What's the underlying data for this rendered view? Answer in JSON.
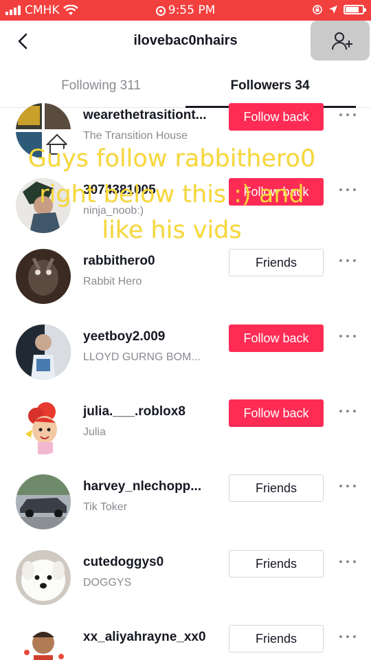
{
  "status_bar": {
    "carrier": "CMHK",
    "time": "9:55 PM",
    "battery_level": 0.8
  },
  "header": {
    "title": "ilovebac0nhairs"
  },
  "tabs": {
    "following": "Following 311",
    "followers": "Followers 34"
  },
  "caption": {
    "line1": "Guys follow rabbithero0",
    "line2": "right below this :) and",
    "line3": "like his vids"
  },
  "followers": [
    {
      "username": "wearethetrasitiont...",
      "nickname": "The Transition House",
      "button": "Follow back",
      "style": "red"
    },
    {
      "username": "3074381005",
      "nickname": "ninja_noob:)",
      "button": "Follow back",
      "style": "red"
    },
    {
      "username": "rabbithero0",
      "nickname": "Rabbit Hero",
      "button": "Friends",
      "style": "white"
    },
    {
      "username": "yeetboy2.009",
      "nickname": "LLOYD GURNG BOM...",
      "button": "Follow back",
      "style": "red"
    },
    {
      "username": "julia.___.roblox8",
      "nickname": "Julia",
      "button": "Follow back",
      "style": "red"
    },
    {
      "username": "harvey_nlechopp...",
      "nickname": "Tik Toker",
      "button": "Friends",
      "style": "white"
    },
    {
      "username": "cutedoggys0",
      "nickname": "DOGGYS",
      "button": "Friends",
      "style": "white"
    },
    {
      "username": "xx_aliyahrayne_xx0",
      "nickname": "",
      "button": "Friends",
      "style": "white"
    }
  ],
  "colors": {
    "status_bar": "#f2403f",
    "follow_back": "#fe2c55",
    "caption": "#f8d83a"
  }
}
